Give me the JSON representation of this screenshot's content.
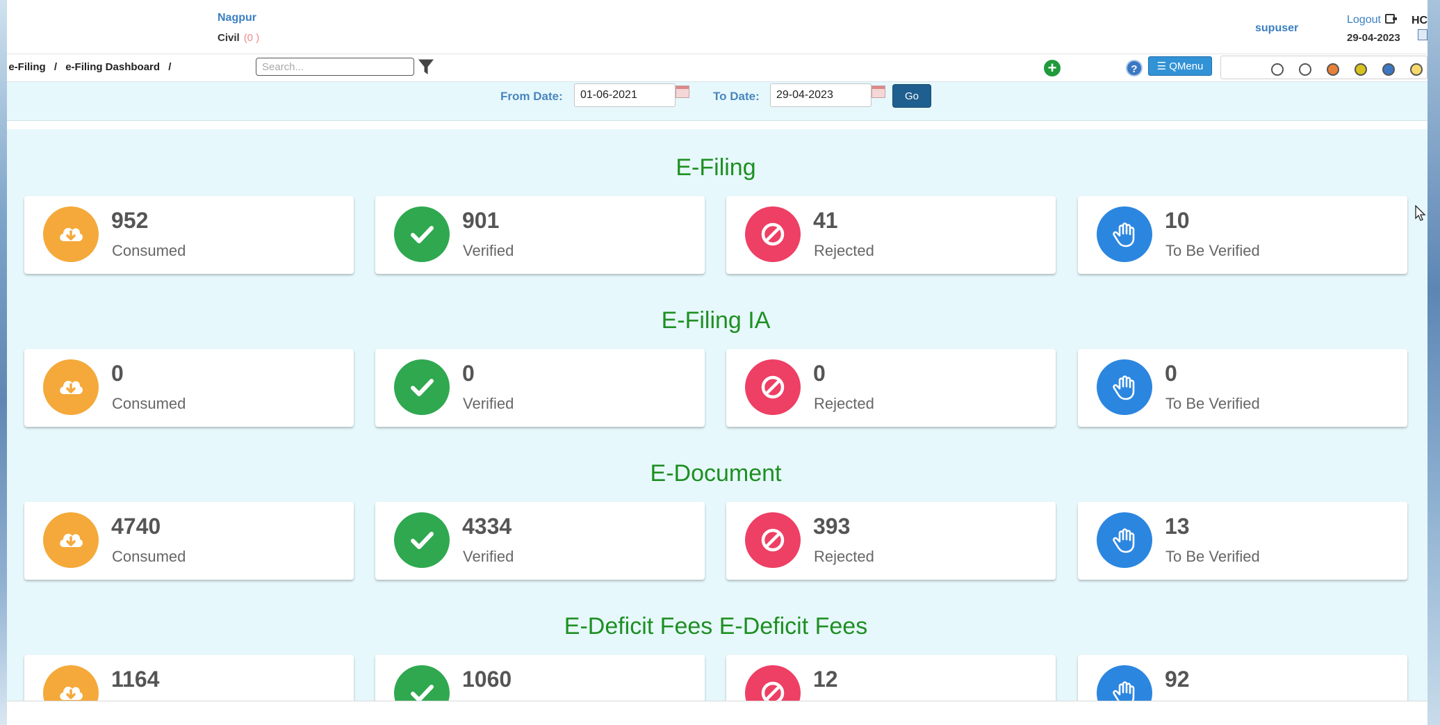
{
  "header": {
    "city": "Nagpur",
    "side": "Civil",
    "side_count": "(0 )",
    "user": "supuser",
    "logout": "Logout",
    "court_code": "HC",
    "date": "29-04-2023"
  },
  "toolbar": {
    "breadcrumb": [
      "e-Filing",
      "e-Filing Dashboard"
    ],
    "search_placeholder": "Search...",
    "qmenu_label": "QMenu",
    "help_label": "?",
    "add_label": "+"
  },
  "theme_dots": [
    "#ffffff",
    "#ffffff",
    "#e8803a",
    "#d8c21e",
    "#3c78c2",
    "#f7d86a"
  ],
  "date_filter": {
    "from_label": "From Date:",
    "from_value": "01-06-2021",
    "to_label": "To Date:",
    "to_value": "29-04-2023",
    "go_label": "Go"
  },
  "captions": {
    "consumed": "Consumed",
    "verified": "Verified",
    "rejected": "Rejected",
    "to_be_verified": "To Be Verified"
  },
  "sections": [
    {
      "title": "E-Filing",
      "consumed": "952",
      "verified": "901",
      "rejected": "41",
      "to_be_verified": "10"
    },
    {
      "title": "E-Filing IA",
      "consumed": "0",
      "verified": "0",
      "rejected": "0",
      "to_be_verified": "0"
    },
    {
      "title": "E-Document",
      "consumed": "4740",
      "verified": "4334",
      "rejected": "393",
      "to_be_verified": "13"
    },
    {
      "title": "E-Deficit Fees E-Deficit Fees",
      "consumed": "1164",
      "verified": "1060",
      "rejected": "12",
      "to_be_verified": "92"
    }
  ],
  "colors": {
    "consumed": "#f4a93a",
    "verified": "#2fa84f",
    "rejected": "#ee3f64",
    "to_be_verified": "#2b86e0",
    "section_title": "#1e8f22"
  }
}
